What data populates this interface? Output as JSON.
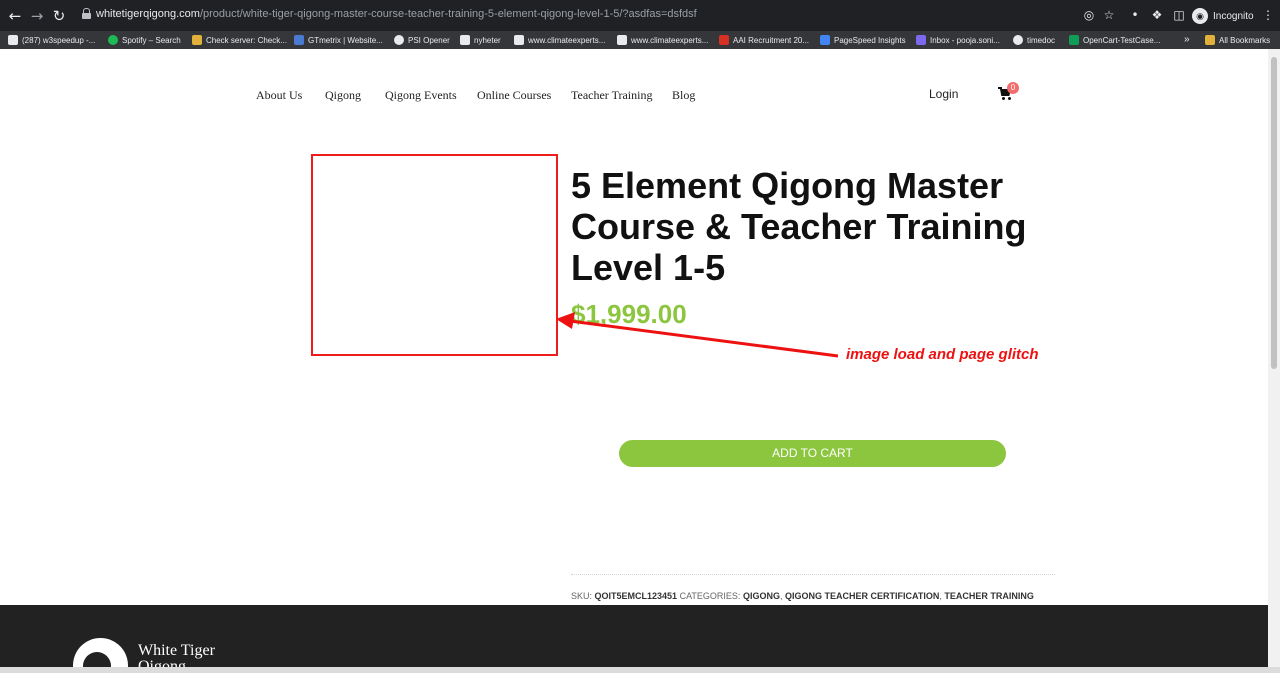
{
  "browser": {
    "url_host": "whitetigerqigong.com",
    "url_path": "/product/white-tiger-qigong-master-course-teacher-training-5-element-qigong-level-1-5/?asdfas=dsfdsf",
    "incognito_label": "Incognito",
    "bookmarks": [
      {
        "label": "(287) w3speedup -...",
        "color": "#e8eaed"
      },
      {
        "label": "Spotify – Search",
        "color": "#1db954"
      },
      {
        "label": "Check server: Check...",
        "color": "#e2b13c"
      },
      {
        "label": "GTmetrix | Website...",
        "color": "#4a7bd0"
      },
      {
        "label": "PSI Opener",
        "color": "#e8eaed"
      },
      {
        "label": "nyheter",
        "color": "#e8eaed"
      },
      {
        "label": "www.climateexperts...",
        "color": "#e8eaed"
      },
      {
        "label": "www.climateexperts...",
        "color": "#e8eaed"
      },
      {
        "label": "AAI Recruitment 20...",
        "color": "#d93025"
      },
      {
        "label": "PageSpeed Insights",
        "color": "#4285f4"
      },
      {
        "label": "Inbox - pooja.soni...",
        "color": "#7b68ee"
      },
      {
        "label": "timedoc",
        "color": "#e8eaed"
      },
      {
        "label": "OpenCart-TestCase...",
        "color": "#0f9d58"
      }
    ],
    "bookmarks_overflow": "»",
    "all_bookmarks": "All Bookmarks"
  },
  "site": {
    "nav": [
      "About Us",
      "Qigong",
      "Qigong Events",
      "Online Courses",
      "Teacher Training",
      "Blog"
    ],
    "login": "Login",
    "cart_count": "0"
  },
  "product": {
    "title": "5 Element Qigong Master Course & Teacher Training Level 1-5",
    "price": "$1,999.00",
    "add_to_cart": "ADD TO CART",
    "sku_label": "SKU:",
    "sku": "QOIT5EMCL123451",
    "categories_label": "CATEGORIES:",
    "categories": [
      "QIGONG",
      "QIGONG TEACHER CERTIFICATION",
      "TEACHER TRAINING"
    ]
  },
  "annotation": {
    "text": "image load and page glitch",
    "color": "#ee1111"
  },
  "footer": {
    "brand_line1": "White Tiger",
    "brand_line2": "Qigong"
  },
  "colors": {
    "accent_green": "#8cc63f",
    "footer_bg": "#222222"
  }
}
